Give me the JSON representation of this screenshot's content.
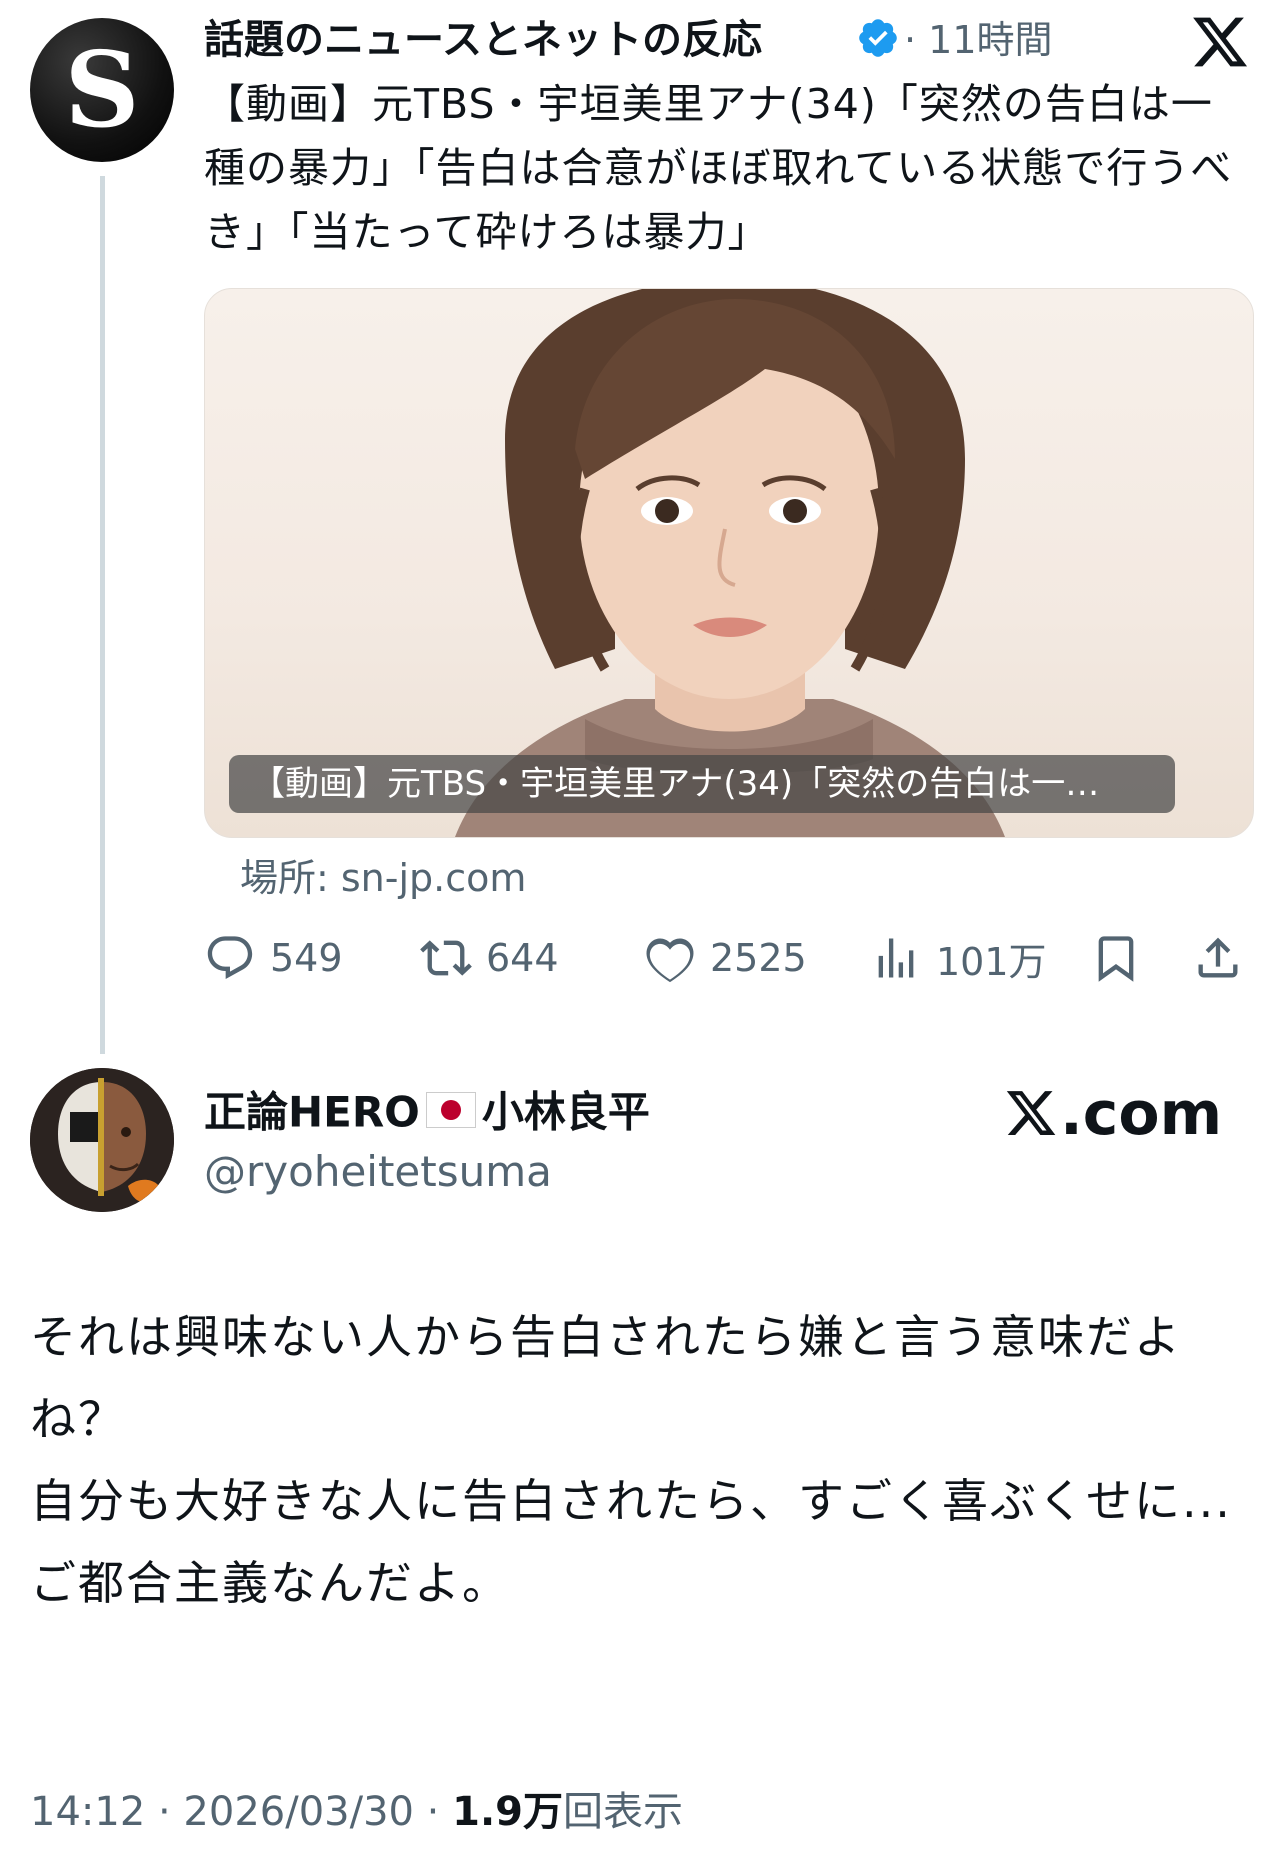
{
  "quoted_tweet": {
    "avatar_letter": "S",
    "name": "話題のニュースとネットの反応",
    "time": "· 11時間",
    "text": "【動画】元TBS・宇垣美里アナ(34)「突然の告白は一種の暴力」「告白は合意がほぼ取れている状態で行うべき」「当たって砕けろは暴力」",
    "card_caption": "【動画】元TBS・宇垣美里アナ(34)「突然の告白は一…",
    "domain": "場所: sn-jp.com",
    "actions": {
      "replies": "549",
      "retweets": "644",
      "likes": "2525",
      "views": "101万"
    }
  },
  "main_tweet": {
    "name": "正論HERO",
    "name_suffix": "小林良平",
    "handle": "@ryoheitetsuma",
    "watermark": ".com",
    "body": [
      "それは興味ない人から告白されたら嫌と言う意味だよね？",
      "自分も大好きな人に告白されたら、すごく喜ぶくせに...",
      "ご都合主義なんだよ。"
    ],
    "meta_time": "14:12 · 2026/03/30 · ",
    "meta_views": "1.9万",
    "meta_views_label": "回表示"
  },
  "icons": {
    "verified": "verified-badge-icon",
    "x_logo": "x-logo-icon",
    "reply": "reply-icon",
    "retweet": "retweet-icon",
    "like": "heart-icon",
    "views": "views-icon",
    "bookmark": "bookmark-icon",
    "share": "share-icon"
  },
  "colors": {
    "text": "#0f1419",
    "secondary": "#536471",
    "verified": "#1d9bf0"
  }
}
